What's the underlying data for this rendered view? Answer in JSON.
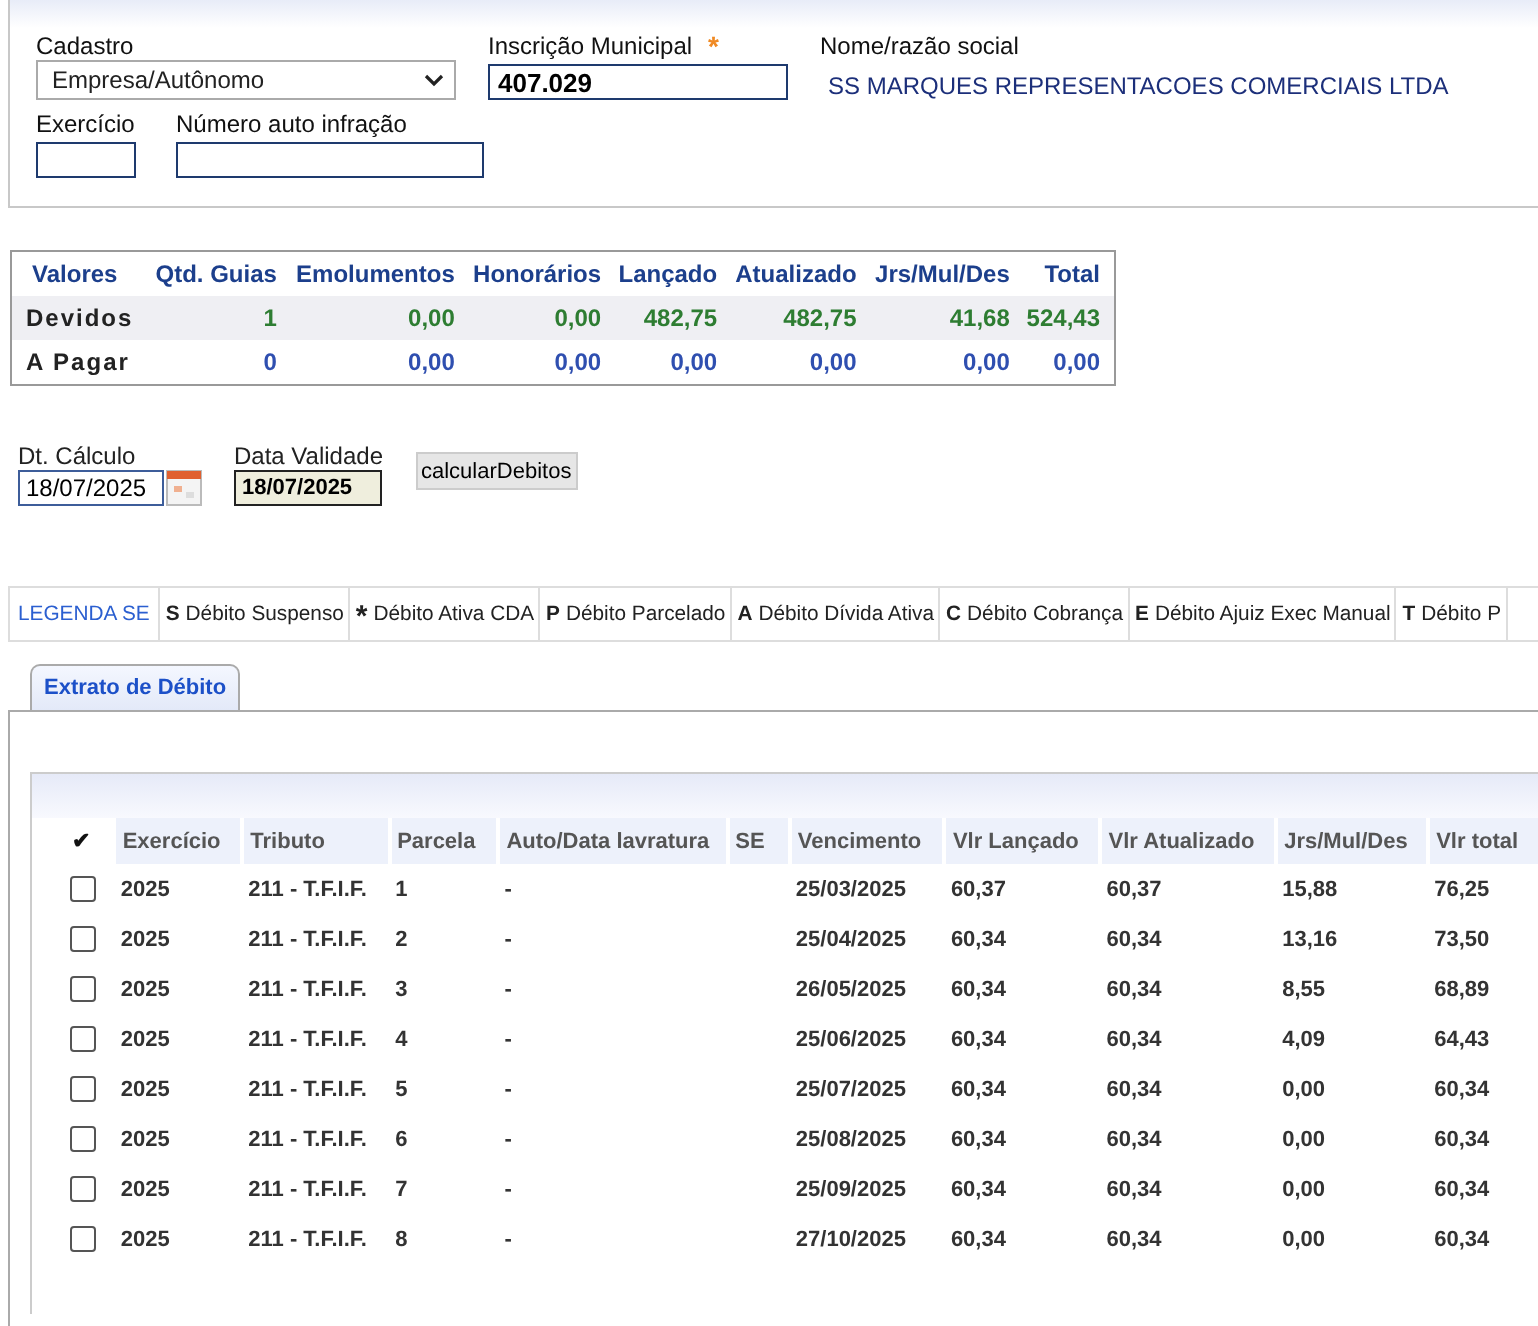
{
  "filters": {
    "cadastro": {
      "label": "Cadastro",
      "value": "Empresa/Autônomo"
    },
    "inscricao": {
      "label": "Inscrição Municipal",
      "required_mark": "*",
      "value": "407.029"
    },
    "nome": {
      "label": "Nome/razão social",
      "value": "SS MARQUES REPRESENTACOES COMERCIAIS LTDA"
    },
    "exercicio": {
      "label": "Exercício"
    },
    "auto": {
      "label": "Número auto infração"
    }
  },
  "summary": {
    "columns": [
      "Valores",
      "Qtd. Guias",
      "Emolumentos",
      "Honorários",
      "Lançado",
      "Atualizado",
      "Jrs/Mul/Des",
      "Total"
    ],
    "rows": [
      {
        "kind": "devidos",
        "cells": [
          "Devidos",
          "1",
          "0,00",
          "0,00",
          "482,75",
          "482,75",
          "41,68",
          "524,43"
        ]
      },
      {
        "kind": "pagar",
        "cells": [
          "A Pagar",
          "0",
          "0,00",
          "0,00",
          "0,00",
          "0,00",
          "0,00",
          "0,00"
        ]
      }
    ]
  },
  "calc": {
    "dt_calculo": {
      "label": "Dt. Cálculo",
      "value": "18/07/2025"
    },
    "data_validade": {
      "label": "Data Validade",
      "value": "18/07/2025"
    },
    "button": "calcularDebitos"
  },
  "legend": {
    "title": "LEGENDA SE",
    "items": [
      {
        "code": "S",
        "label": "Débito Suspenso"
      },
      {
        "code": "*",
        "label": "Débito Ativa CDA"
      },
      {
        "code": "P",
        "label": "Débito Parcelado"
      },
      {
        "code": "A",
        "label": "Débito Dívida Ativa"
      },
      {
        "code": "C",
        "label": "Débito Cobrança"
      },
      {
        "code": "E",
        "label": "Débito Ajuiz Exec Manual"
      },
      {
        "code": "T",
        "label": "Débito P"
      }
    ]
  },
  "tabs": [
    {
      "label": "Extrato de Débito",
      "selected": true
    }
  ],
  "table": {
    "check_header": "✔",
    "columns": [
      "Exercício",
      "Tributo",
      "Parcela",
      "Auto/Data lavratura",
      "SE",
      "Vencimento",
      "Vlr Lançado",
      "Vlr Atualizado",
      "Jrs/Mul/Des",
      "Vlr total"
    ],
    "rows": [
      {
        "checked": false,
        "cells": [
          "2025",
          "211 - T.F.I.F.",
          "1",
          "-",
          "",
          "25/03/2025",
          "60,37",
          "60,37",
          "15,88",
          "76,25"
        ]
      },
      {
        "checked": false,
        "cells": [
          "2025",
          "211 - T.F.I.F.",
          "2",
          "-",
          "",
          "25/04/2025",
          "60,34",
          "60,34",
          "13,16",
          "73,50"
        ]
      },
      {
        "checked": false,
        "cells": [
          "2025",
          "211 - T.F.I.F.",
          "3",
          "-",
          "",
          "26/05/2025",
          "60,34",
          "60,34",
          "8,55",
          "68,89"
        ]
      },
      {
        "checked": false,
        "cells": [
          "2025",
          "211 - T.F.I.F.",
          "4",
          "-",
          "",
          "25/06/2025",
          "60,34",
          "60,34",
          "4,09",
          "64,43"
        ]
      },
      {
        "checked": false,
        "cells": [
          "2025",
          "211 - T.F.I.F.",
          "5",
          "-",
          "",
          "25/07/2025",
          "60,34",
          "60,34",
          "0,00",
          "60,34"
        ]
      },
      {
        "checked": false,
        "cells": [
          "2025",
          "211 - T.F.I.F.",
          "6",
          "-",
          "",
          "25/08/2025",
          "60,34",
          "60,34",
          "0,00",
          "60,34"
        ]
      },
      {
        "checked": false,
        "cells": [
          "2025",
          "211 - T.F.I.F.",
          "7",
          "-",
          "",
          "25/09/2025",
          "60,34",
          "60,34",
          "0,00",
          "60,34"
        ]
      },
      {
        "checked": false,
        "cells": [
          "2025",
          "211 - T.F.I.F.",
          "8",
          "-",
          "",
          "27/10/2025",
          "60,34",
          "60,34",
          "0,00",
          "60,34"
        ]
      }
    ]
  }
}
